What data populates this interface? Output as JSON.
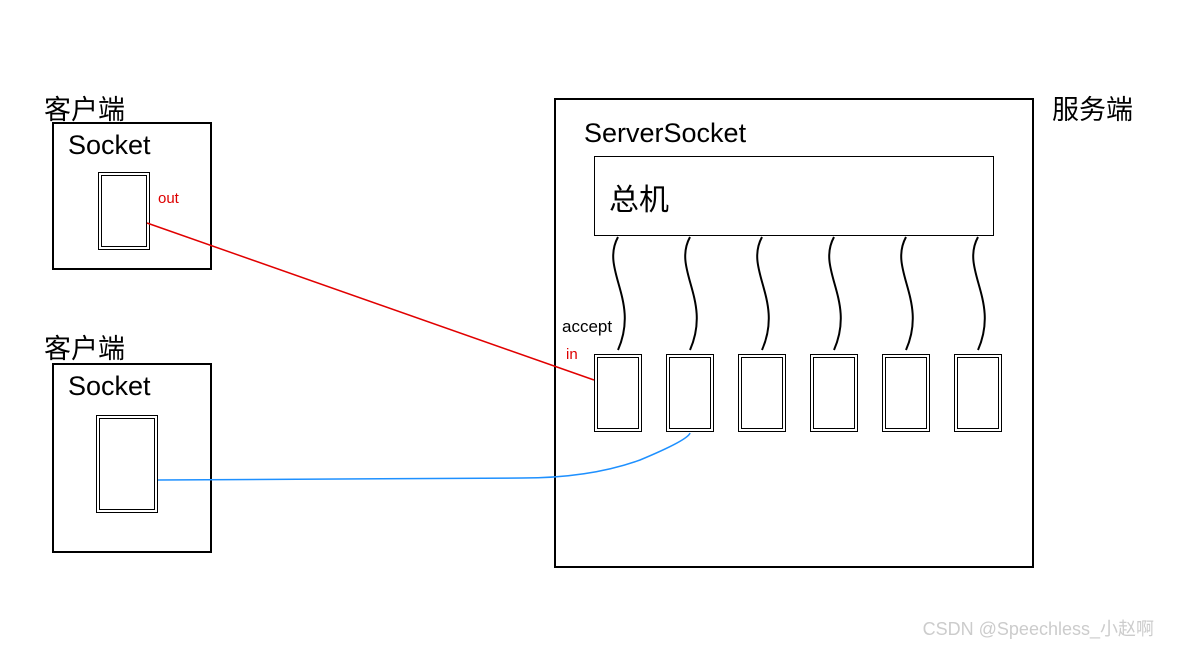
{
  "client1": {
    "title": "客户端",
    "socket": "Socket",
    "out_label": "out"
  },
  "client2": {
    "title": "客户端",
    "socket": "Socket"
  },
  "server": {
    "title": "服务端",
    "serversocket": "ServerSocket",
    "switchboard": "总机",
    "accept": "accept",
    "in_label": "in"
  },
  "watermark": "CSDN @Speechless_小赵啊"
}
